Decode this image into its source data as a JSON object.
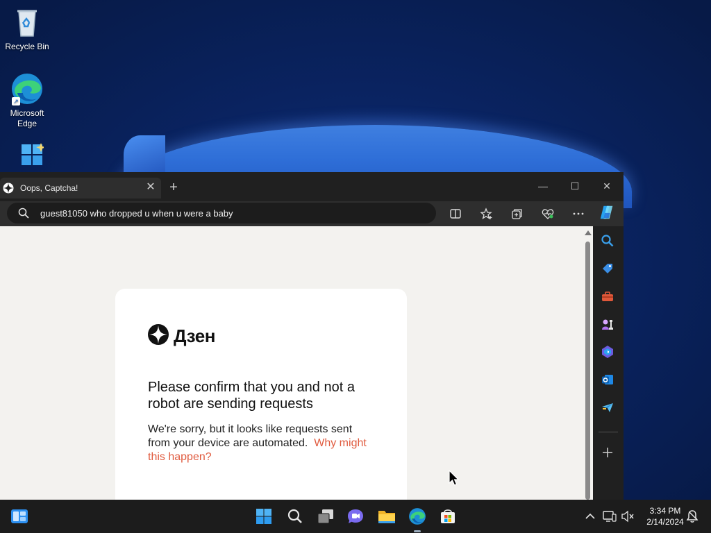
{
  "desktop": {
    "icons": [
      {
        "label": "Recycle Bin"
      },
      {
        "label": "Microsoft Edge"
      },
      {
        "label": ""
      }
    ]
  },
  "browser": {
    "tab": {
      "title": "Oops, Captcha!"
    },
    "address": {
      "text": "guest81050 who dropped u when u were a baby"
    },
    "page": {
      "logo_text": "Дзен",
      "heading": "Please confirm that you and not a robot are sending requests",
      "paragraph": "We're sorry, but it looks like requests sent from your device are automated.",
      "link_text": "Why might this happen?"
    },
    "colors": {
      "link": "#e05b3f",
      "tab_bg": "#2e2e2e",
      "page_bg": "#f3f2ef"
    }
  },
  "taskbar": {
    "time": "3:34 PM",
    "date": "2/14/2024"
  }
}
